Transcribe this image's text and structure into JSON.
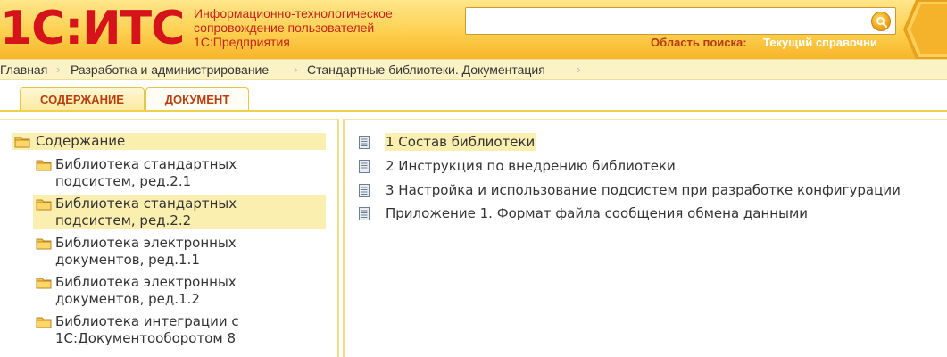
{
  "header": {
    "logo_text": "1С:ИТС",
    "tagline": [
      "Информационно-технологическое",
      "сопровождение пользователей",
      "1С:Предприятия"
    ],
    "search": {
      "value": "",
      "placeholder": ""
    },
    "search_area_label": "Область поиска:",
    "search_area_value": "Текущий справочни"
  },
  "breadcrumb": [
    "Главная",
    "Разработка и администрирование",
    "Стандартные библиотеки. Документация"
  ],
  "tabs": [
    {
      "label": "СОДЕРЖАНИЕ",
      "active": true
    },
    {
      "label": "ДОКУМЕНТ",
      "active": false
    }
  ],
  "tree": {
    "root": "Содержание",
    "items": [
      {
        "lines": [
          "Библиотека стандартных",
          "подсистем, ред.2.1"
        ],
        "selected": false
      },
      {
        "lines": [
          "Библиотека стандартных",
          "подсистем, ред.2.2"
        ],
        "selected": true
      },
      {
        "lines": [
          "Библиотека электронных",
          "документов, ред.1.1"
        ],
        "selected": false
      },
      {
        "lines": [
          "Библиотека электронных",
          "документов, ред.1.2"
        ],
        "selected": false
      },
      {
        "lines": [
          "Библиотека интеграции с",
          "1С:Документооборотом 8"
        ],
        "selected": false
      }
    ]
  },
  "documents": [
    {
      "label": "1 Состав библиотеки",
      "selected": true
    },
    {
      "label": "2 Инструкция по внедрению библиотеки",
      "selected": false
    },
    {
      "label": "3 Настройка и использование подсистем при разработке конфигурации",
      "selected": false
    },
    {
      "label": "Приложение 1. Формат файла сообщения обмена данными",
      "selected": false
    }
  ],
  "colors": {
    "logo": "#d4131b",
    "header_bg": "#fdd04f",
    "selection": "#fbefb0",
    "tab_text": "#b8400f"
  },
  "icons": {
    "search": "magnifier-icon",
    "folder": "folder-icon",
    "document": "document-icon",
    "breadcrumb_sep": "chevron-right-icon"
  }
}
